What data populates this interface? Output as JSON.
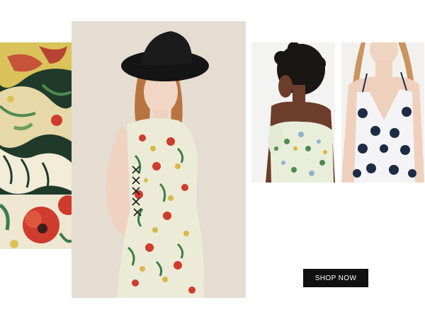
{
  "cta": {
    "label": "SHOP NOW"
  },
  "colors": {
    "button_bg": "#111111",
    "button_text": "#ffffff",
    "page_bg": "#ffffff",
    "studio_backdrop": "#e6ddd2",
    "dress_print_base": "#ecebd7",
    "poppy_red": "#cf3b2c",
    "leaf_green": "#3b7d4a",
    "navy_floral": "#1d2b45"
  }
}
